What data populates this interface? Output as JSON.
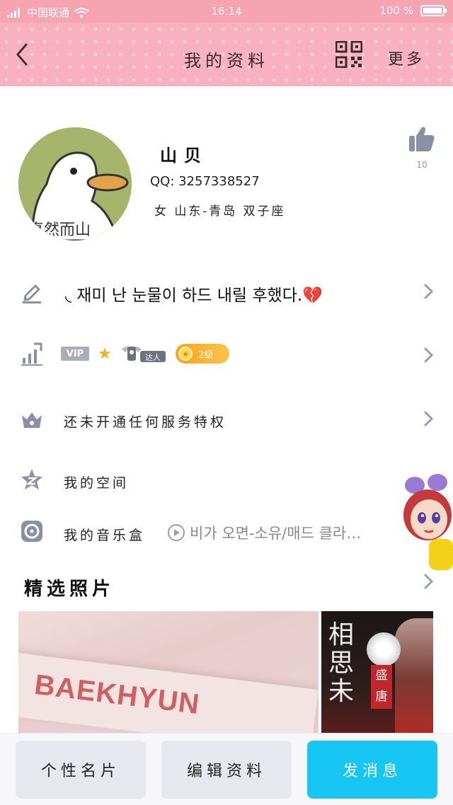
{
  "status_bar": {
    "carrier": "中国联通",
    "time": "16:14",
    "battery": "100 %",
    "battery_level": 1.0
  },
  "header": {
    "title": "我的资料",
    "more_label": "更多"
  },
  "profile": {
    "nickname": "山贝",
    "qq_line": "QQ: 3257338527",
    "info_line": "女  山东-青岛  双子座",
    "like_count": "10",
    "avatar_caption": "真然而山"
  },
  "rows": {
    "signature": "◟ 재미 난 눈물이 하드 내릴 후했다.💔",
    "badges": {
      "vip": "VIP",
      "talent": "达人",
      "level": "2級"
    },
    "services": "还未开通任何服务特权",
    "space": "我的空间",
    "music_box": "我的音乐盒",
    "music_track": "비가 오면-소유/매드 클라…"
  },
  "photos": {
    "section_title": "精选照片",
    "photo1_text": "BAEKHYUN",
    "photo2_text": "相思未",
    "photo2_seal": "盛唐"
  },
  "bottom_bar": {
    "card_label": "个性名片",
    "edit_label": "编辑资料",
    "message_label": "发消息"
  },
  "colors": {
    "header_pink": "#f7b1c0",
    "status_pink": "#f6a3b2",
    "accent_blue": "#17c6f2",
    "icon_gray": "#8a90a6"
  }
}
